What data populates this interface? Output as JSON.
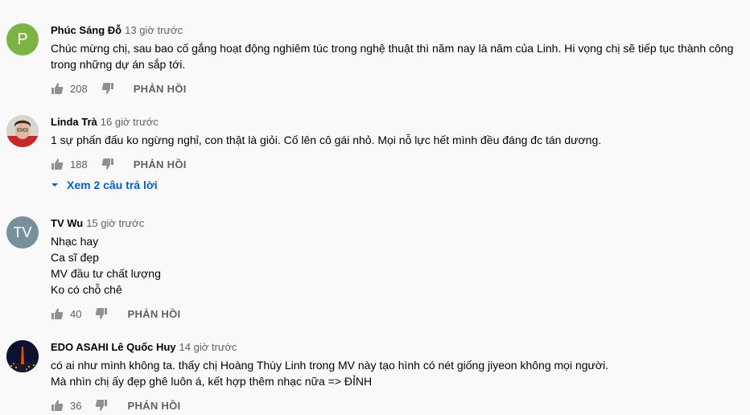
{
  "comments": [
    {
      "author": "Phúc Sáng Đỗ",
      "time": "13 giờ trước",
      "avatar_letter": "P",
      "avatar_color": "#7cb342",
      "lines": [
        "Chúc mừng chị, sau bao cố gắng hoạt động nghiêm túc trong nghệ thuật thì năm nay là năm của Linh. Hi vọng chị sẽ tiếp tục thành công",
        "trong những dự án sắp tới."
      ],
      "likes": "208",
      "reply_label": "PHẢN HỒI"
    },
    {
      "author": "Linda Trà",
      "time": "16 giờ trước",
      "lines": [
        "1 sự phấn đấu ko ngừng nghỉ, con thật là giỏi. Cố lên cô gái nhỏ. Mọi nỗ lực hết mình đều đáng đc tán dương."
      ],
      "likes": "188",
      "reply_label": "PHẢN HỒI",
      "view_replies": "Xem 2 câu trả lời"
    },
    {
      "author": "TV Wu",
      "time": "15 giờ trước",
      "avatar_letter": "TV",
      "avatar_color": "#78909c",
      "lines": [
        "Nhạc hay",
        "Ca sĩ đẹp",
        "MV đầu tư chất lượng",
        "Ko có chỗ chê"
      ],
      "likes": "40",
      "reply_label": "PHẢN HỒI"
    },
    {
      "author": "EDO ASAHI Lê Quốc Huy",
      "time": "14 giờ trước",
      "lines": [
        "có ai như mình không ta. thấy chị Hoàng Thùy Linh trong MV này tạo hình có nét giống jiyeon không mọi người.",
        "Mà nhìn chị ấy đẹp ghê luôn á, kết hợp thêm nhạc nữa => ĐỈNH"
      ],
      "likes": "36",
      "reply_label": "PHẢN HỒI"
    }
  ],
  "icons": {
    "like": "thumbs-up-icon",
    "dislike": "thumbs-down-icon",
    "expand": "caret-down-icon"
  },
  "colors": {
    "link": "#065fd4",
    "meta": "#606060"
  }
}
